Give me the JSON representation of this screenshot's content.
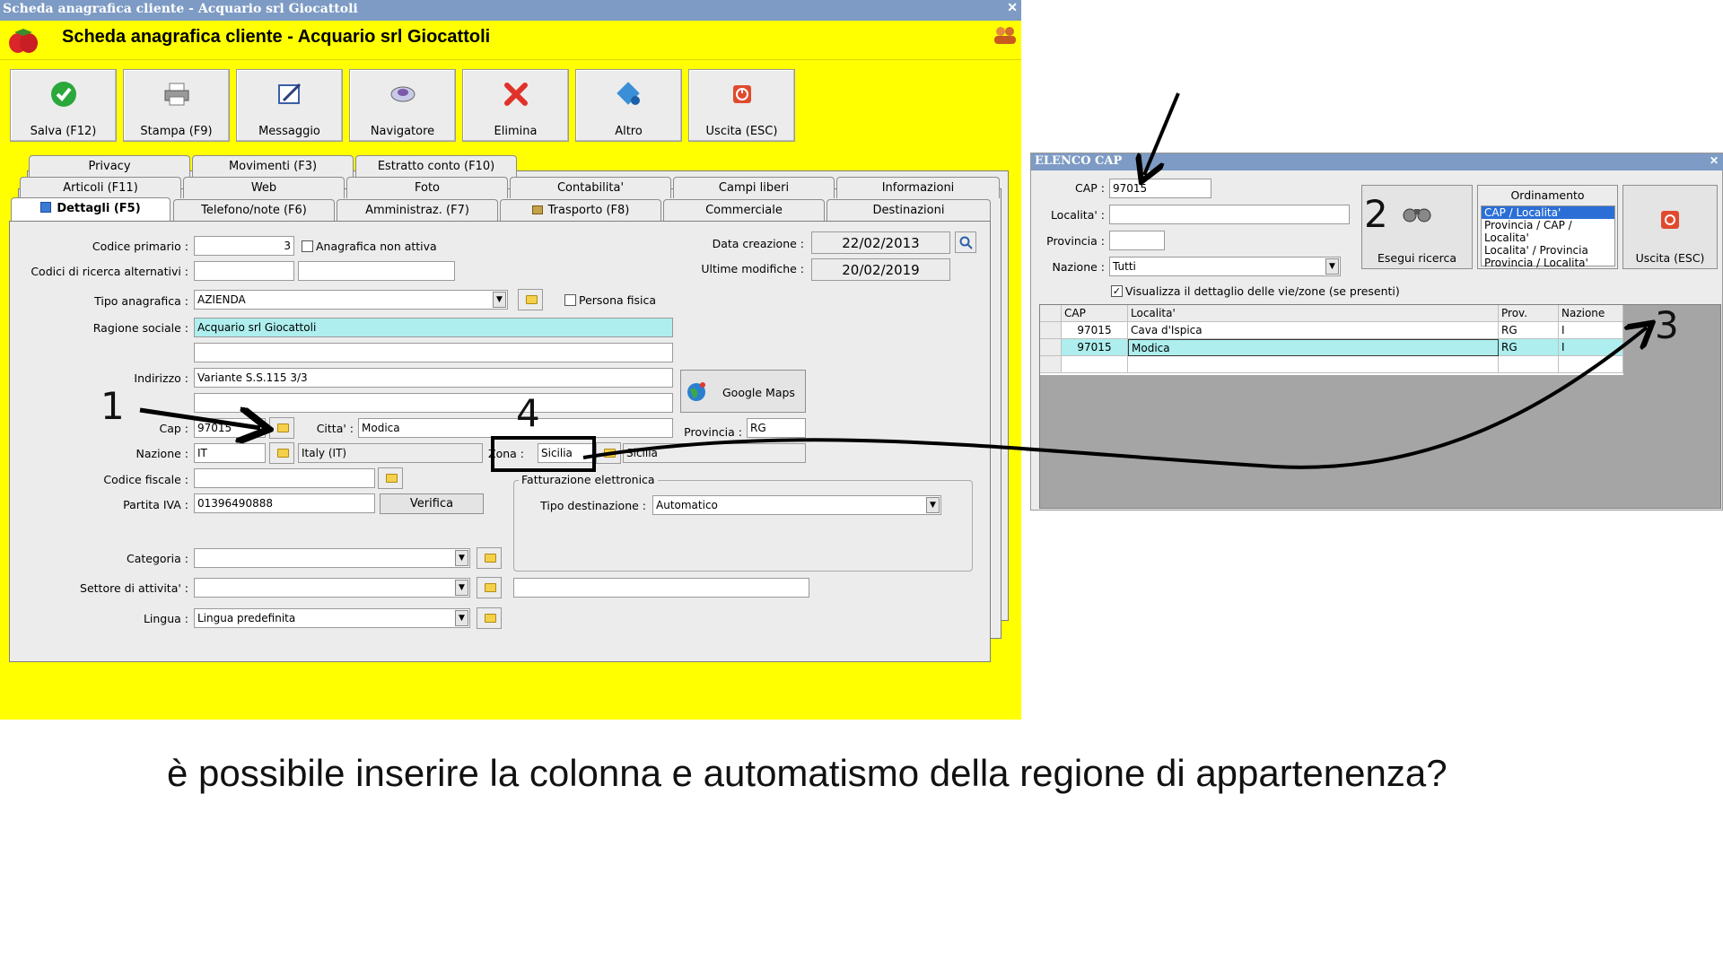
{
  "main_window": {
    "titlebar": "Scheda anagrafica cliente - Acquario srl Giocattoli",
    "header_title": "Scheda anagrafica cliente - Acquario srl Giocattoli",
    "toolbar": [
      {
        "label": "Salva (F12)",
        "icon": "check-icon"
      },
      {
        "label": "Stampa (F9)",
        "icon": "printer-icon"
      },
      {
        "label": "Messaggio",
        "icon": "message-icon"
      },
      {
        "label": "Navigatore",
        "icon": "navigator-icon"
      },
      {
        "label": "Elimina",
        "icon": "delete-x-icon"
      },
      {
        "label": "Altro",
        "icon": "other-icon"
      },
      {
        "label": "Uscita (ESC)",
        "icon": "exit-icon"
      }
    ],
    "tabs_row1": [
      "Privacy",
      "Movimenti (F3)",
      "Estratto conto (F10)"
    ],
    "tabs_row2": [
      "Articoli (F11)",
      "Web",
      "Foto",
      "Contabilita'",
      "Campi liberi",
      "Informazioni"
    ],
    "tabs_row3": [
      "Dettagli (F5)",
      "Telefono/note (F6)",
      "Amministraz. (F7)",
      "Trasporto (F8)",
      "Commerciale",
      "Destinazioni"
    ],
    "form": {
      "codice_primario_label": "Codice primario :",
      "codice_primario_value": "3",
      "anagrafica_non_attiva_label": "Anagrafica non attiva",
      "codici_ricerca_label": "Codici di ricerca alternativi :",
      "tipo_anagrafica_label": "Tipo anagrafica :",
      "tipo_anagrafica_value": "AZIENDA",
      "persona_fisica_label": "Persona fisica",
      "ragione_sociale_label": "Ragione sociale :",
      "ragione_sociale_value": "Acquario srl Giocattoli",
      "indirizzo_label": "Indirizzo :",
      "indirizzo_value": "Variante S.S.115 3/3",
      "google_maps_label": "Google Maps",
      "cap_label": "Cap :",
      "cap_value": "97015",
      "citta_label": "Citta' :",
      "citta_value": "Modica",
      "provincia_label": "Provincia :",
      "provincia_value": "RG",
      "nazione_label": "Nazione :",
      "nazione_value": "IT",
      "nazione_desc": "Italy (IT)",
      "zona_label": "Zona :",
      "zona_value": "Sicilia",
      "zona_desc": "Sicilia",
      "codice_fiscale_label": "Codice fiscale :",
      "partita_iva_label": "Partita IVA :",
      "partita_iva_value": "01396490888",
      "verifica_label": "Verifica",
      "fatturazione_group": "Fatturazione elettronica",
      "tipo_destinazione_label": "Tipo destinazione :",
      "tipo_destinazione_value": "Automatico",
      "categoria_label": "Categoria :",
      "settore_label": "Settore di attivita' :",
      "lingua_label": "Lingua :",
      "lingua_value": "Lingua predefinita",
      "data_creazione_label": "Data creazione :",
      "data_creazione_value": "22/02/2013",
      "ultime_modifiche_label": "Ultime modifiche :",
      "ultime_modifiche_value": "20/02/2019"
    }
  },
  "cap_window": {
    "title": "ELENCO CAP",
    "cap_label": "CAP :",
    "cap_value": "97015",
    "localita_label": "Localita' :",
    "provincia_label": "Provincia :",
    "nazione_label": "Nazione :",
    "nazione_value": "Tutti",
    "esegui_ricerca_label": "Esegui ricerca",
    "ordinamento_label": "Ordinamento",
    "ordinamento_options": [
      "CAP / Localita'",
      "Provincia / CAP / Localita'",
      "Localita' / Provincia",
      "Provincia / Localita'"
    ],
    "uscita_label": "Uscita (ESC)",
    "visualizza_label": "Visualizza il dettaglio delle vie/zone (se presenti)",
    "columns": [
      "CAP",
      "Localita'",
      "Prov.",
      "Nazione"
    ],
    "rows": [
      [
        "97015",
        "Cava d'Ispica",
        "RG",
        "I"
      ],
      [
        "97015",
        "Modica",
        "RG",
        "I"
      ]
    ]
  },
  "annotations": {
    "n1": "1",
    "n2": "2",
    "n3": "3",
    "n4": "4",
    "question": "è possibile inserire la colonna e automatismo della regione di appartenenza?"
  }
}
